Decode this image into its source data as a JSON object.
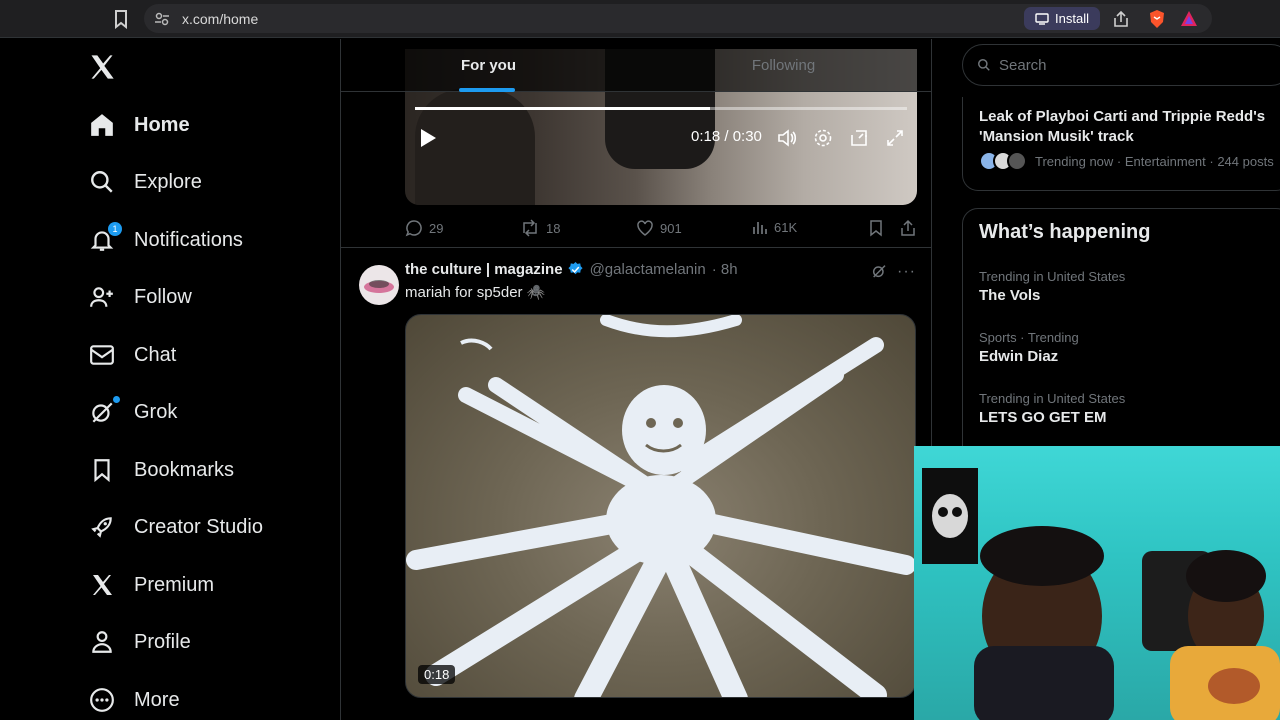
{
  "browser": {
    "url": "x.com/home",
    "install_label": "Install"
  },
  "nav": {
    "items": [
      {
        "label": "Home",
        "icon": "home-icon"
      },
      {
        "label": "Explore",
        "icon": "search-icon"
      },
      {
        "label": "Notifications",
        "icon": "bell-icon",
        "badge": "1"
      },
      {
        "label": "Follow",
        "icon": "person-add-icon"
      },
      {
        "label": "Chat",
        "icon": "mail-icon"
      },
      {
        "label": "Grok",
        "icon": "grok-icon"
      },
      {
        "label": "Bookmarks",
        "icon": "bookmark-icon"
      },
      {
        "label": "Creator Studio",
        "icon": "rocket-icon"
      },
      {
        "label": "Premium",
        "icon": "x-logo-icon"
      },
      {
        "label": "Profile",
        "icon": "person-icon"
      },
      {
        "label": "More",
        "icon": "more-circle-icon"
      }
    ]
  },
  "timeline": {
    "tabs": [
      {
        "label": "For you",
        "active": true
      },
      {
        "label": "Following",
        "active": false
      }
    ],
    "video1": {
      "time": "0:18 / 0:30",
      "progress": 0.6
    },
    "tweet1_actions": {
      "replies": "29",
      "reposts": "18",
      "likes": "901",
      "views": "61K"
    },
    "tweet2": {
      "author": "the culture | magazine",
      "handle": "@galactamelanin",
      "time": "· 8h",
      "text": "mariah for sp5der 🕷️",
      "media_time": "0:18"
    }
  },
  "right": {
    "search_placeholder": "Search",
    "news": {
      "title": "Leak of Playboi Carti and Trippie Redd's 'Mansion Musik' track",
      "meta": "Trending now · Entertainment · 244 posts"
    },
    "happening_title": "What’s happening",
    "trends": [
      {
        "category": "Trending in United States",
        "name": "The Vols"
      },
      {
        "category": "Sports · Trending",
        "name": "Edwin Diaz"
      },
      {
        "category": "Trending in United States",
        "name": "LETS GO GET EM"
      }
    ]
  },
  "colors": {
    "accent": "#1d9bf0",
    "background": "#000000",
    "border": "#2f3336",
    "muted": "#71767b"
  }
}
